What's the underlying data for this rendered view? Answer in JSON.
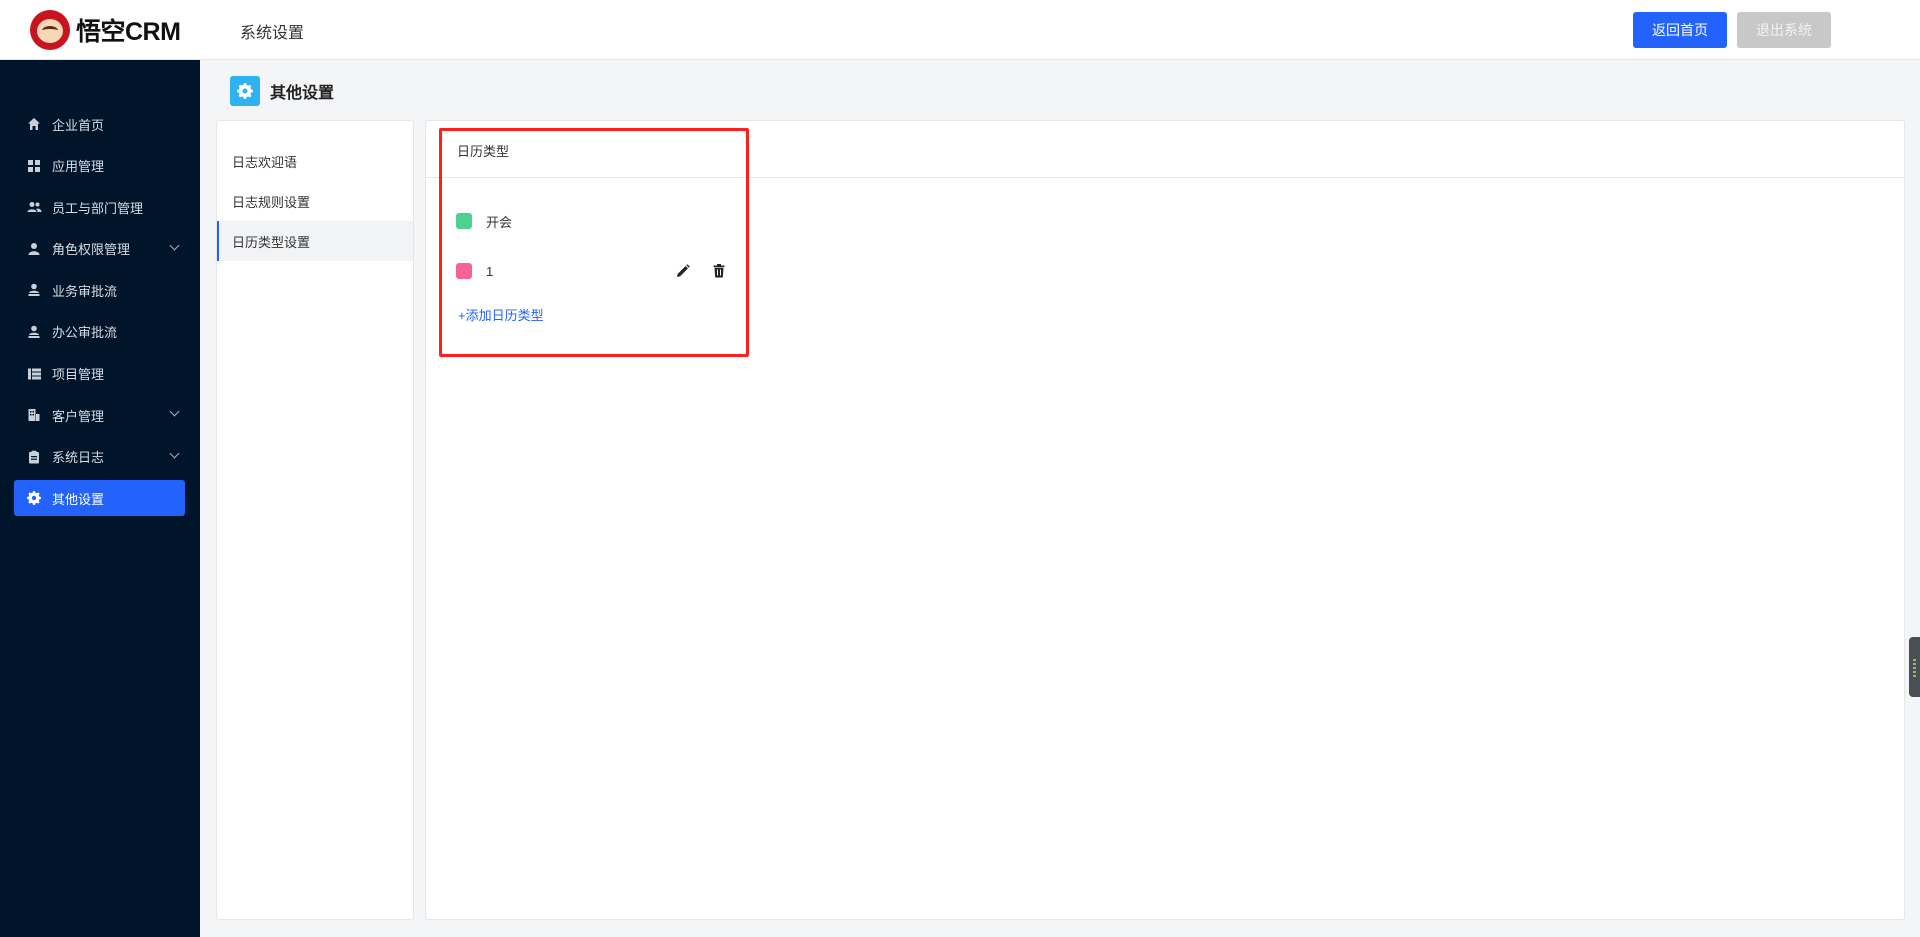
{
  "header": {
    "logo_text": "悟空CRM",
    "title": "系统设置",
    "home_button": "返回首页",
    "exit_button": "退出系统"
  },
  "sidebar": {
    "items": [
      {
        "label": "企业首页",
        "icon": "home-icon"
      },
      {
        "label": "应用管理",
        "icon": "grid-icon"
      },
      {
        "label": "员工与部门管理",
        "icon": "users-icon"
      },
      {
        "label": "角色权限管理",
        "icon": "user-icon",
        "expandable": true
      },
      {
        "label": "业务审批流",
        "icon": "user-stamp-icon"
      },
      {
        "label": "办公审批流",
        "icon": "user-stamp-icon"
      },
      {
        "label": "项目管理",
        "icon": "list-icon"
      },
      {
        "label": "客户管理",
        "icon": "building-icon",
        "expandable": true
      },
      {
        "label": "系统日志",
        "icon": "clipboard-icon",
        "expandable": true
      },
      {
        "label": "其他设置",
        "icon": "gear-icon",
        "active": true
      }
    ],
    "active_color": "#2362fb"
  },
  "page": {
    "title": "其他设置"
  },
  "submenu": {
    "items": [
      {
        "label": "日志欢迎语"
      },
      {
        "label": "日志规则设置"
      },
      {
        "label": "日历类型设置",
        "active": true
      }
    ]
  },
  "calendar_types": {
    "title": "日历类型",
    "items": [
      {
        "label": "开会",
        "color": "#4cd18f"
      },
      {
        "label": "1",
        "color": "#f56394"
      }
    ],
    "add_label": "+添加日历类型"
  }
}
